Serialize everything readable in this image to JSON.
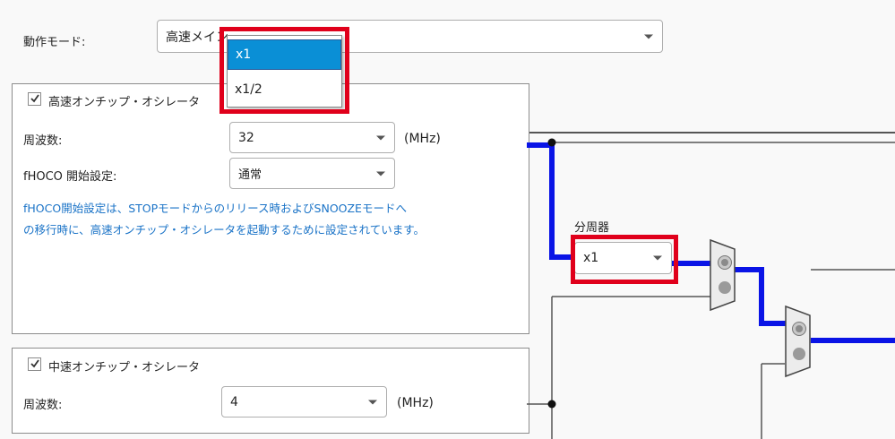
{
  "mode": {
    "label": "動作モード:",
    "value": "高速メイン"
  },
  "high_speed_osc": {
    "title": "高速オンチップ・オシレータ",
    "checked": true,
    "freq_label": "周波数:",
    "freq_value": "32",
    "freq_unit": "(MHz)",
    "fhoco_label": "fHOCO 開始設定:",
    "fhoco_value": "通常",
    "note_line1": "fHOCO開始設定は、STOPモードからのリリース時およびSNOOZEモードへ",
    "note_line2": "の移行時に、高速オンチップ・オシレータを起動するために設定されています。"
  },
  "mid_speed_osc": {
    "title": "中速オンチップ・オシレータ",
    "checked": true,
    "freq_label": "周波数:",
    "freq_value": "4",
    "freq_unit": "(MHz)"
  },
  "divider": {
    "label": "分周器",
    "value": "x1"
  },
  "dropdown_options": [
    {
      "label": "x1",
      "selected": true
    },
    {
      "label": "x1/2",
      "selected": false
    }
  ],
  "colors": {
    "wire_active": "#0a14e6",
    "highlight": "#e0001b",
    "selected": "#0a8fd6"
  }
}
